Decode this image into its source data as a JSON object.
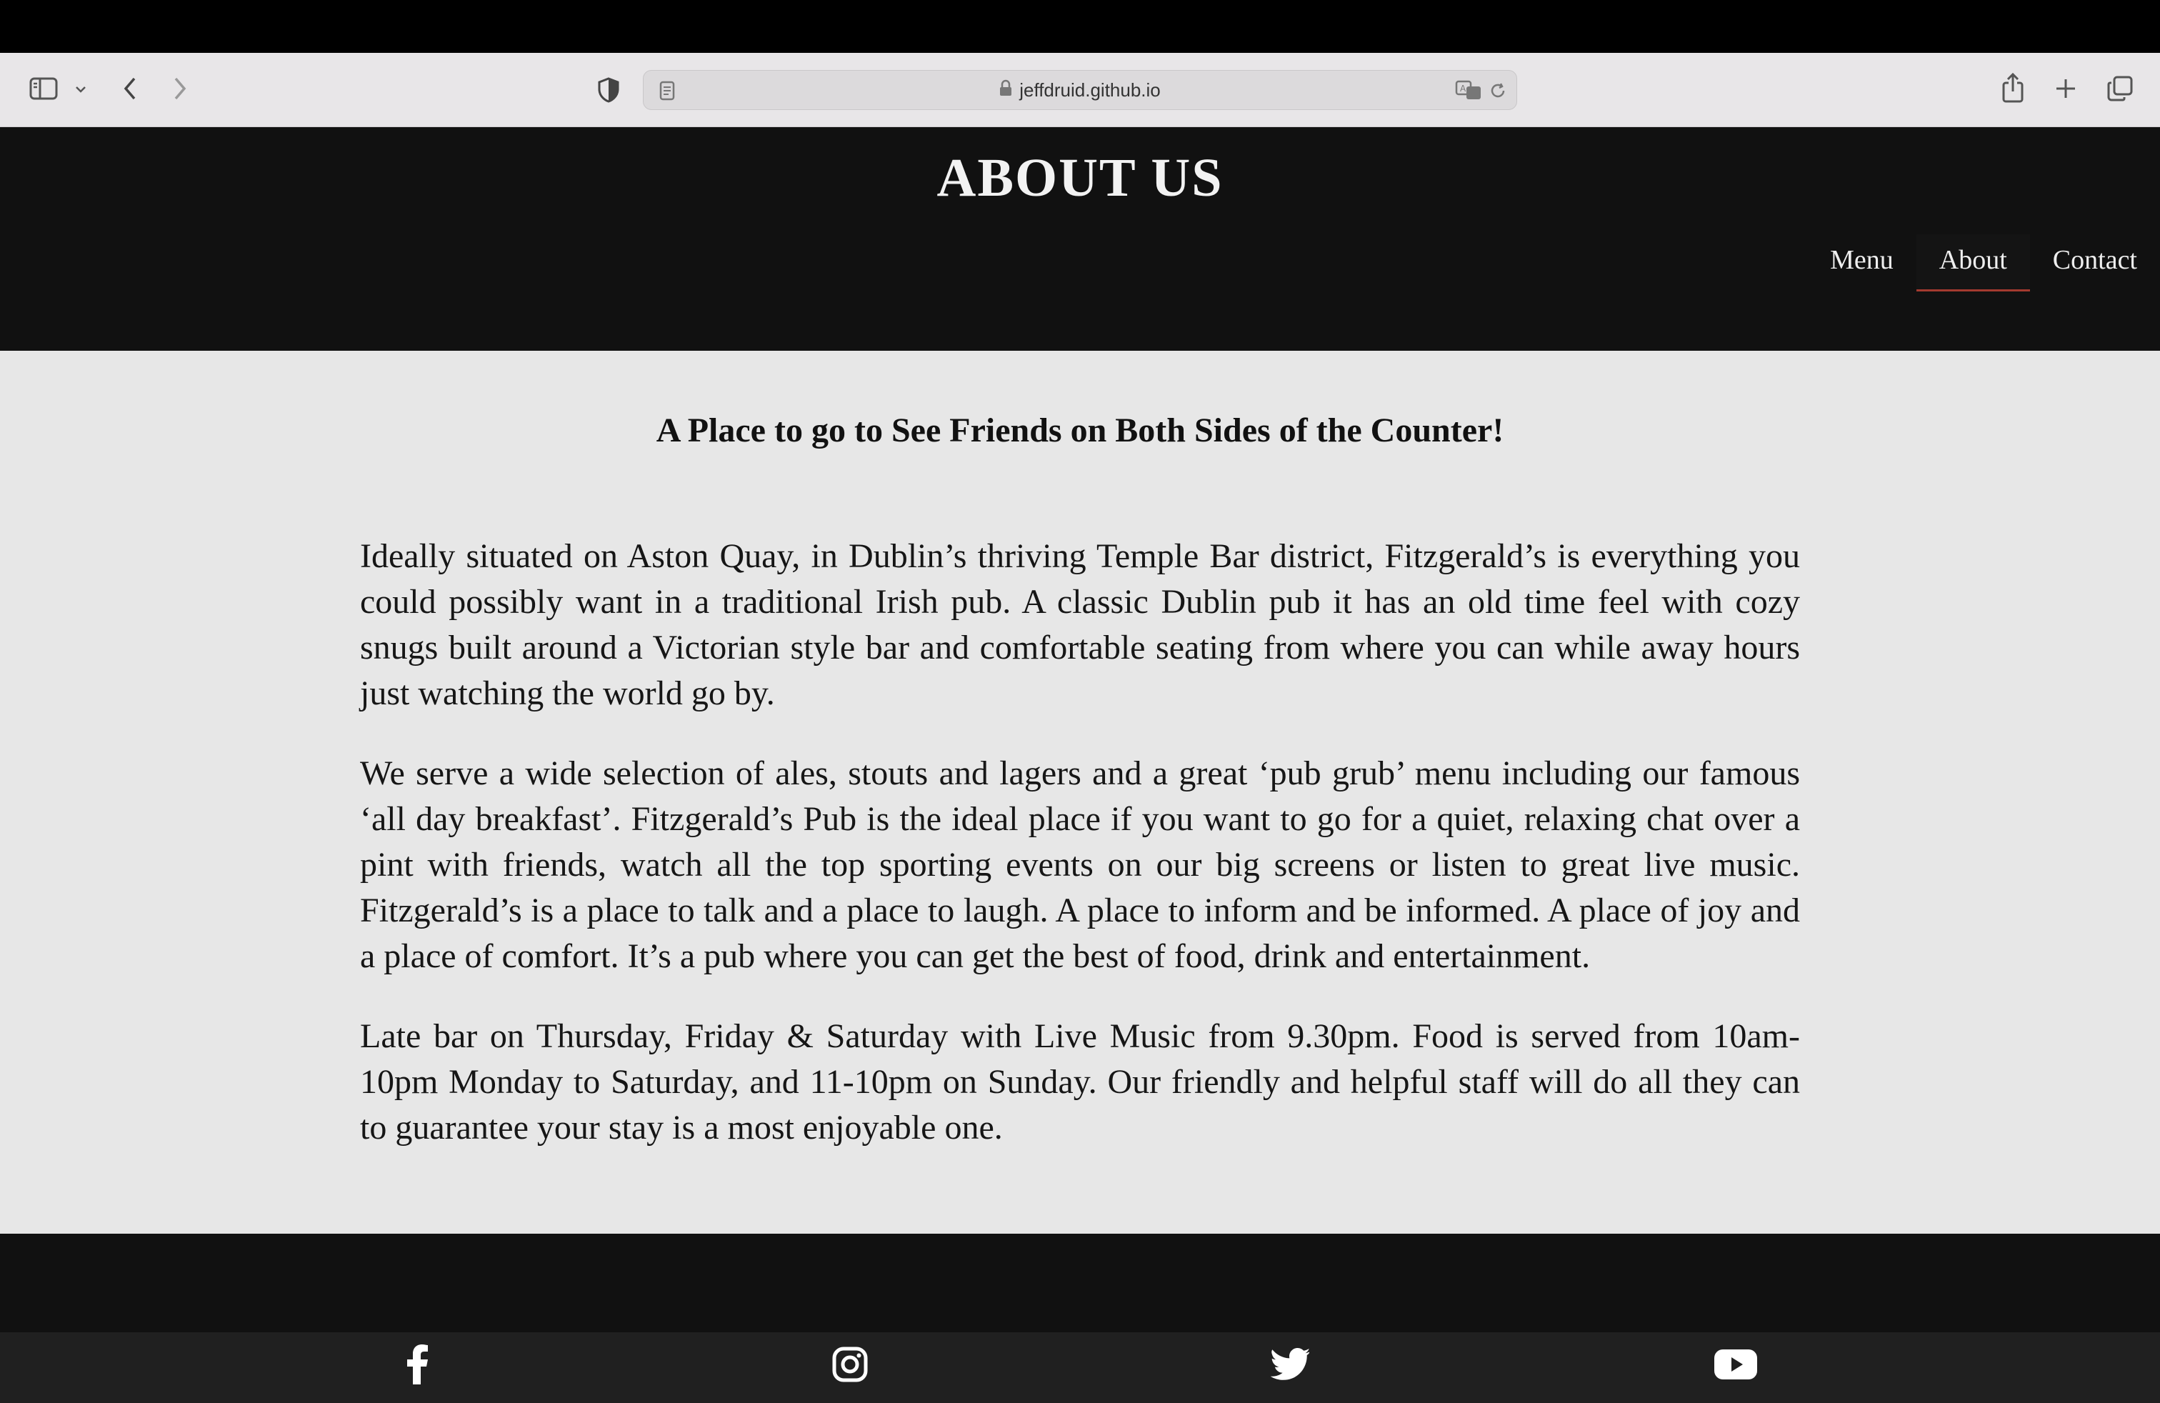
{
  "browser": {
    "url": "jeffdruid.github.io",
    "icons": {
      "sidebar": "sidebar-icon",
      "chevron": "chevron-down-icon",
      "back": "back-arrow-icon",
      "forward": "forward-arrow-icon",
      "privacy": "shield-icon",
      "reader": "reader-icon",
      "lock": "lock-icon",
      "translate": "translate-icon",
      "reload": "reload-icon",
      "share": "share-icon",
      "new_tab": "plus-icon",
      "tabs": "tabs-overview-icon"
    }
  },
  "header": {
    "title": "ABOUT US",
    "nav": [
      {
        "label": "Menu",
        "active": false
      },
      {
        "label": "About",
        "active": true
      },
      {
        "label": "Contact",
        "active": false
      }
    ]
  },
  "main": {
    "tagline": "A Place to go to See Friends on Both Sides of the Counter!",
    "paragraphs": [
      "Ideally situated on Aston Quay, in Dublin’s thriving Temple Bar district, Fitzgerald’s is everything you could possibly want in a traditional Irish pub. A classic Dublin pub it has an old time feel with cozy snugs built around a Victorian style bar and comfortable seating from where you can while away hours just watching the world go by.",
      "We serve a wide selection of ales, stouts and lagers and a great ‘pub grub’ menu including our famous ‘all day breakfast’. Fitzgerald’s Pub is the ideal place if you want to go for a quiet, relaxing chat over a pint with friends, watch all the top sporting events on our big screens or listen to great live music. Fitzgerald’s is a place to talk and a place to laugh. A place to inform and be informed. A place of joy and a place of comfort. It’s a pub where you can get the best of food, drink and entertainment.",
      "Late bar on Thursday, Friday & Saturday with Live Music from 9.30pm. Food is served from 10am-10pm Monday to Saturday, and 11-10pm on Sunday. Our friendly and helpful staff will do all they can to guarantee your stay is a most enjoyable one."
    ]
  },
  "footer": {
    "social": [
      "facebook-icon",
      "instagram-icon",
      "twitter-icon",
      "youtube-icon"
    ]
  },
  "colors": {
    "header_bg": "#111111",
    "content_bg": "#e7e7e7",
    "nav_active_underline": "#a43a2f",
    "footer_bar": "#202020"
  }
}
